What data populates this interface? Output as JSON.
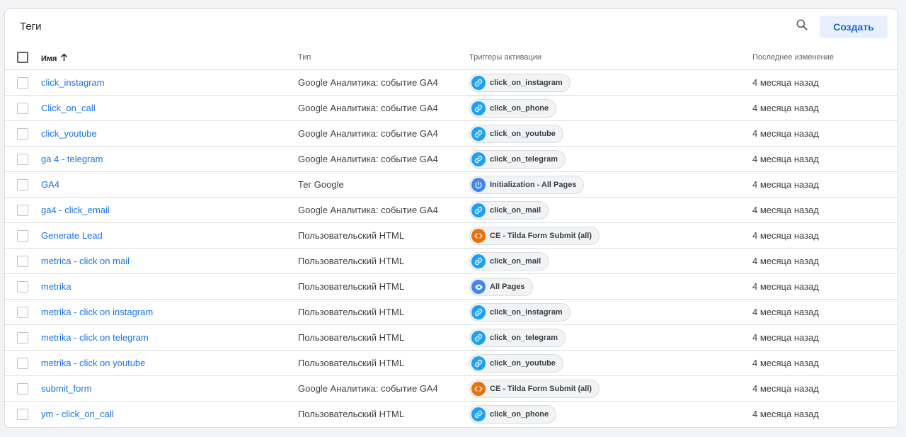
{
  "header": {
    "title": "Теги",
    "create_label": "Создать"
  },
  "columns": {
    "name": "Имя",
    "type": "Тип",
    "triggers": "Триггеры активации",
    "modified": "Последнее изменение"
  },
  "colors": {
    "link_blue": "#1a73e8",
    "link_icon": "#1ea1f2",
    "power_icon": "#4285f4",
    "eye_icon": "#4285f4",
    "code_icon": "#e8710a"
  },
  "rows": [
    {
      "name": "click_instagram",
      "type": "Google Аналитика: событие GA4",
      "trigger": "click_on_instagram",
      "icon": "link-icon",
      "modified": "4 месяца назад"
    },
    {
      "name": "Click_on_call",
      "type": "Google Аналитика: событие GA4",
      "trigger": "click_on_phone",
      "icon": "link-icon",
      "modified": "4 месяца назад"
    },
    {
      "name": "click_youtube",
      "type": "Google Аналитика: событие GA4",
      "trigger": "click_on_youtube",
      "icon": "link-icon",
      "modified": "4 месяца назад"
    },
    {
      "name": "ga 4 - telegram",
      "type": "Google Аналитика: событие GA4",
      "trigger": "click_on_telegram",
      "icon": "link-icon",
      "modified": "4 месяца назад"
    },
    {
      "name": "GA4",
      "type": "Тег Google",
      "trigger": "Initialization - All Pages",
      "icon": "power-icon",
      "modified": "4 месяца назад"
    },
    {
      "name": "ga4 - click_email",
      "type": "Google Аналитика: событие GA4",
      "trigger": "click_on_mail",
      "icon": "link-icon",
      "modified": "4 месяца назад"
    },
    {
      "name": "Generate Lead",
      "type": "Пользовательский HTML",
      "trigger": "CE - Tilda Form Submit (all)",
      "icon": "code-icon",
      "modified": "4 месяца назад"
    },
    {
      "name": "metrica - click on mail",
      "type": "Пользовательский HTML",
      "trigger": "click_on_mail",
      "icon": "link-icon",
      "modified": "4 месяца назад"
    },
    {
      "name": "metrika",
      "type": "Пользовательский HTML",
      "trigger": "All Pages",
      "icon": "eye-icon",
      "modified": "4 месяца назад"
    },
    {
      "name": "metrika - click on instagram",
      "type": "Пользовательский HTML",
      "trigger": "click_on_instagram",
      "icon": "link-icon",
      "modified": "4 месяца назад"
    },
    {
      "name": "metrika - click on telegram",
      "type": "Пользовательский HTML",
      "trigger": "click_on_telegram",
      "icon": "link-icon",
      "modified": "4 месяца назад"
    },
    {
      "name": "metrika - click on youtube",
      "type": "Пользовательский HTML",
      "trigger": "click_on_youtube",
      "icon": "link-icon",
      "modified": "4 месяца назад"
    },
    {
      "name": "submit_form",
      "type": "Google Аналитика: событие GA4",
      "trigger": "CE - Tilda Form Submit (all)",
      "icon": "code-icon",
      "modified": "4 месяца назад"
    },
    {
      "name": "ym - click_on_call",
      "type": "Пользовательский HTML",
      "trigger": "click_on_phone",
      "icon": "link-icon",
      "modified": "4 месяца назад"
    }
  ]
}
